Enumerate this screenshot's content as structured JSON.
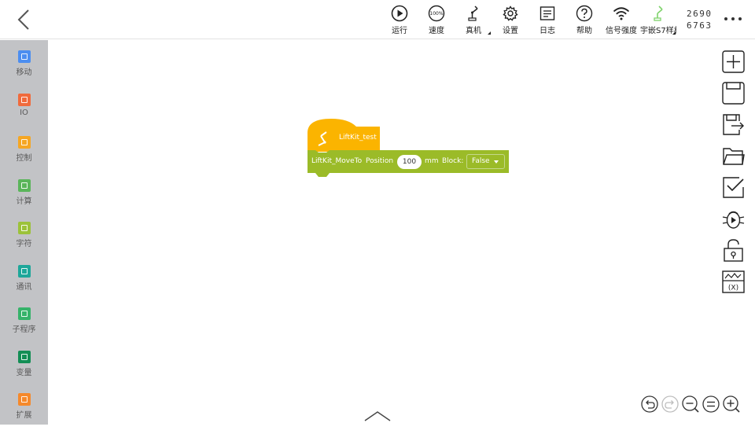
{
  "toolbar": {
    "tools": [
      {
        "id": "run",
        "label": "运行",
        "icon": "play-icon"
      },
      {
        "id": "speed",
        "label": "速度",
        "icon": "speed-gauge-icon",
        "value": "100%"
      },
      {
        "id": "real",
        "label": "真机",
        "icon": "robot-arm-icon"
      },
      {
        "id": "settings",
        "label": "设置",
        "icon": "gear-icon"
      },
      {
        "id": "log",
        "label": "日志",
        "icon": "log-icon"
      },
      {
        "id": "help",
        "label": "帮助",
        "icon": "help-icon"
      },
      {
        "id": "signal",
        "label": "信号强度",
        "icon": "wifi-icon"
      },
      {
        "id": "device",
        "label": "宇嵌S7样机",
        "icon": "robot-arm-green-icon"
      }
    ],
    "serial_line1": "2690",
    "serial_line2": "6763",
    "accent": "#7fd36b"
  },
  "sidebar": {
    "background": "#c2c3c6",
    "categories": [
      {
        "label": "移动",
        "color": "#4c8ef0",
        "icon": "move-icon"
      },
      {
        "label": "IO",
        "color": "#f06a3c",
        "icon": "io-icon"
      },
      {
        "label": "控制",
        "color": "#f5a623",
        "icon": "control-icon"
      },
      {
        "label": "计算",
        "color": "#5ab55a",
        "icon": "calc-icon"
      },
      {
        "label": "字符",
        "color": "#9cc23a",
        "icon": "string-icon"
      },
      {
        "label": "通讯",
        "color": "#1ea79a",
        "icon": "comm-icon"
      },
      {
        "label": "子程序",
        "color": "#36b36a",
        "icon": "subroutine-icon"
      },
      {
        "label": "变量",
        "color": "#138e55",
        "icon": "variable-icon"
      },
      {
        "label": "扩展",
        "color": "#f5892b",
        "icon": "extension-icon"
      }
    ]
  },
  "workspace": {
    "hat_block": {
      "label": "LiftKit_test",
      "color": "#fbb400"
    },
    "command_block": {
      "color": "#9bbb28",
      "name": "LiftKit_MoveTo",
      "position_label": "Position",
      "position_value": "100",
      "unit": "mm",
      "block_label": "Block:",
      "block_value": "False"
    }
  },
  "right_tools": [
    {
      "id": "new",
      "icon": "new-file-icon"
    },
    {
      "id": "save",
      "icon": "save-icon"
    },
    {
      "id": "save-as",
      "icon": "save-as-icon"
    },
    {
      "id": "open",
      "icon": "folder-icon"
    },
    {
      "id": "check",
      "icon": "checklist-icon"
    },
    {
      "id": "debug",
      "icon": "debug-bug-icon"
    },
    {
      "id": "lock",
      "icon": "unlock-icon"
    },
    {
      "id": "variables",
      "icon": "variable-monitor-icon",
      "text": "(X)"
    }
  ],
  "zoom_controls": [
    {
      "id": "undo",
      "icon": "undo-icon"
    },
    {
      "id": "redo",
      "icon": "redo-icon"
    },
    {
      "id": "zoom-out",
      "icon": "zoom-out-icon"
    },
    {
      "id": "reset",
      "icon": "zoom-reset-icon"
    },
    {
      "id": "zoom-in",
      "icon": "zoom-in-icon"
    }
  ]
}
